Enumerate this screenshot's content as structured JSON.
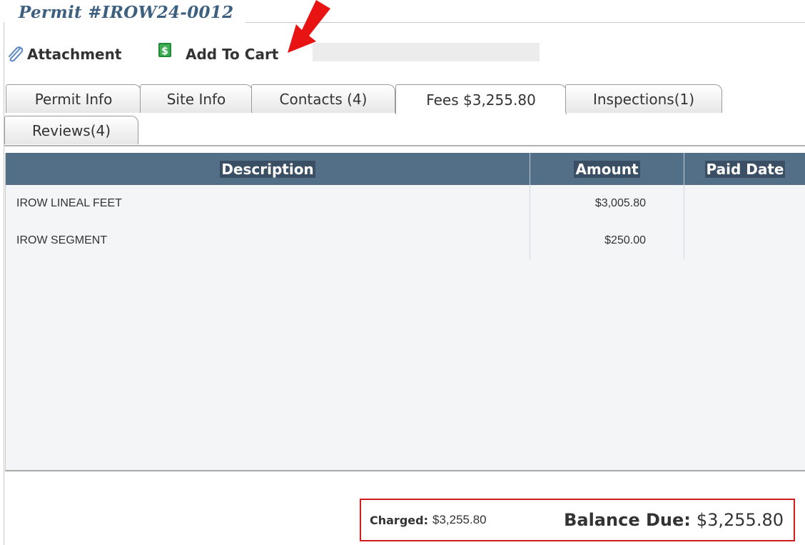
{
  "page": {
    "title": "Permit #IROW24-0012"
  },
  "toolbar": {
    "attachment_label": "Attachment",
    "attachment_icon": "paperclip-icon",
    "add_to_cart_label": "Add To Cart",
    "add_to_cart_icon": "dollar-document-icon"
  },
  "tabs": [
    {
      "label": "Permit Info",
      "active": false
    },
    {
      "label": "Site Info",
      "active": false
    },
    {
      "label": "Contacts (4)",
      "active": false
    },
    {
      "label": "Fees $3,255.80",
      "active": true
    },
    {
      "label": "Inspections(1)",
      "active": false
    },
    {
      "label": "Reviews(4)",
      "active": false
    }
  ],
  "fees_table": {
    "columns": [
      "Description",
      "Amount",
      "Paid Date"
    ],
    "rows": [
      {
        "description": "IROW LINEAL FEET",
        "amount": "$3,005.80",
        "paid_date": ""
      },
      {
        "description": "IROW SEGMENT",
        "amount": "$250.00",
        "paid_date": ""
      }
    ]
  },
  "summary": {
    "charged_label": "Charged:",
    "charged_value": "$3,255.80",
    "balance_label": "Balance Due:",
    "balance_value": "$3,255.80"
  },
  "colors": {
    "title": "#3d5f80",
    "table_header": "#536f88",
    "highlight_box": "#d41c1c",
    "annotation_arrow": "#e81414"
  }
}
